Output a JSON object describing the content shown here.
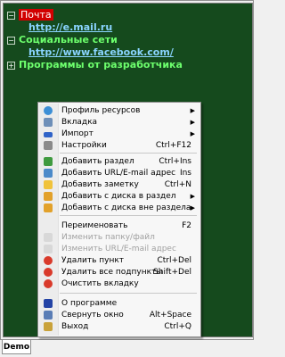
{
  "tree": {
    "nodes": [
      {
        "label": "Почта",
        "kind": "category-selected",
        "toggle": "−"
      },
      {
        "label": "http://e.mail.ru",
        "kind": "link"
      },
      {
        "label": "Социальные сети",
        "kind": "category",
        "toggle": "−"
      },
      {
        "label": "http://www.facebook.com/",
        "kind": "link"
      },
      {
        "label": "Программы от разработчика",
        "kind": "category",
        "toggle": "+"
      }
    ]
  },
  "menu": {
    "items": [
      {
        "label": "Профиль ресурсов",
        "shortcut": "",
        "submenu": true,
        "icon": "globe-icon",
        "disabled": false
      },
      {
        "label": "Вкладка",
        "shortcut": "",
        "submenu": true,
        "icon": "tab-icon",
        "disabled": false
      },
      {
        "label": "Импорт",
        "shortcut": "",
        "submenu": true,
        "icon": "car-icon",
        "disabled": false
      },
      {
        "label": "Настройки",
        "shortcut": "Ctrl+F12",
        "submenu": false,
        "icon": "wrench-icon",
        "disabled": false
      },
      {
        "label": "Добавить раздел",
        "shortcut": "Ctrl+Ins",
        "submenu": false,
        "icon": "folder-add-icon",
        "disabled": false
      },
      {
        "label": "Добавить URL/E-mail адрес",
        "shortcut": "Ins",
        "submenu": false,
        "icon": "link-add-icon",
        "disabled": false
      },
      {
        "label": "Добавить заметку",
        "shortcut": "Ctrl+N",
        "submenu": false,
        "icon": "note-icon",
        "disabled": false
      },
      {
        "label": "Добавить с диска  в раздел",
        "shortcut": "",
        "submenu": true,
        "icon": "disk-icon",
        "disabled": false
      },
      {
        "label": "Добавить  с диска вне раздела",
        "shortcut": "",
        "submenu": true,
        "icon": "disk-icon",
        "disabled": false
      },
      {
        "label": "Переименовать",
        "shortcut": "F2",
        "submenu": false,
        "icon": "rename-icon",
        "disabled": false
      },
      {
        "label": "Изменить папку/файл",
        "shortcut": "",
        "submenu": false,
        "icon": "edit-folder-icon",
        "disabled": true
      },
      {
        "label": "Изменить URL/E-mail адрес",
        "shortcut": "",
        "submenu": false,
        "icon": "edit-link-icon",
        "disabled": true
      },
      {
        "label": "Удалить пункт",
        "shortcut": "Ctrl+Del",
        "submenu": false,
        "icon": "delete-icon",
        "disabled": false
      },
      {
        "label": "Удалить все подпункты",
        "shortcut": "Shift+Del",
        "submenu": false,
        "icon": "delete-all-icon",
        "disabled": false
      },
      {
        "label": "Очистить вкладку",
        "shortcut": "",
        "submenu": false,
        "icon": "clear-icon",
        "disabled": false
      },
      {
        "label": "О программе",
        "shortcut": "",
        "submenu": false,
        "icon": "info-icon",
        "disabled": false
      },
      {
        "label": "Свернуть окно",
        "shortcut": "Alt+Space",
        "submenu": false,
        "icon": "minimize-icon",
        "disabled": false
      },
      {
        "label": "Выход",
        "shortcut": "Ctrl+Q",
        "submenu": false,
        "icon": "exit-icon",
        "disabled": false
      }
    ]
  },
  "tabs": [
    {
      "label": "Demo"
    }
  ],
  "colors": {
    "background": "#154a1d",
    "category": "#6dff6d",
    "link": "#8ad4ff",
    "selected": "#d10000"
  }
}
